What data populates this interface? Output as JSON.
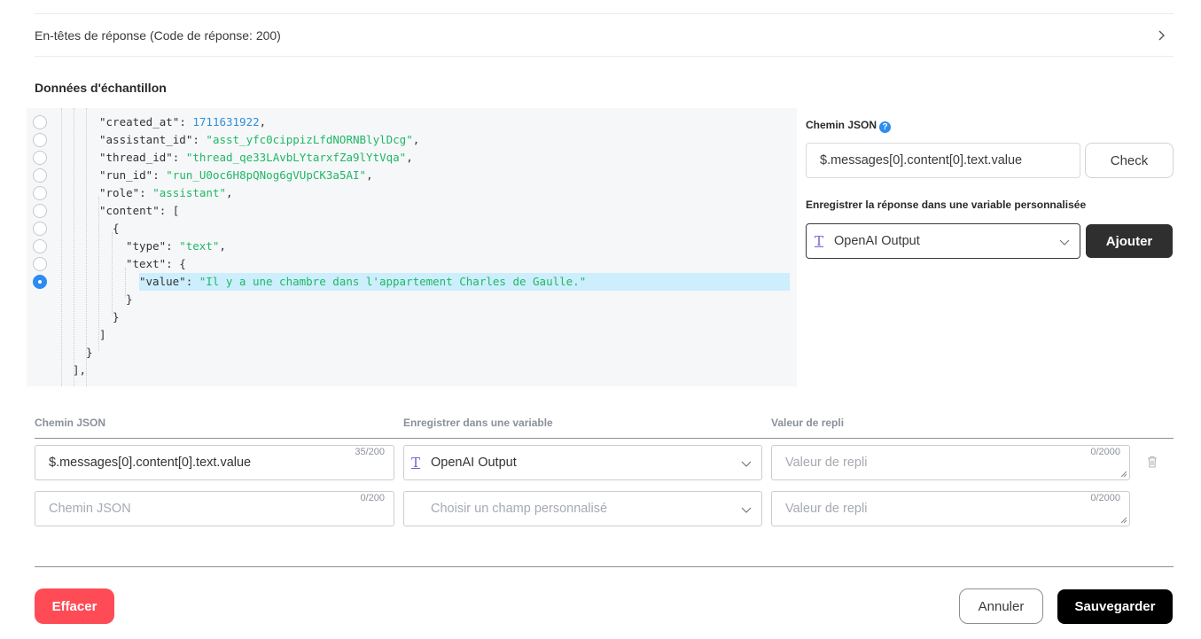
{
  "accordion": {
    "label": "En-têtes de réponse (Code de réponse: 200)",
    "icon": "chevron-right-icon"
  },
  "sample": {
    "title": "Données d'échantillon",
    "lines": [
      {
        "key": "\"created_at\"",
        "sep": ": ",
        "value": "1711631922",
        "vtype": "n",
        "tail": ",",
        "selected": false,
        "has_radio": true
      },
      {
        "key": "\"assistant_id\"",
        "sep": ": ",
        "value": "\"asst_yfc0cippizLfdNORNBlylDcg\"",
        "vtype": "s",
        "tail": ",",
        "selected": false,
        "has_radio": true
      },
      {
        "key": "\"thread_id\"",
        "sep": ": ",
        "value": "\"thread_qe33LAvbLYtarxfZa9lYtVqa\"",
        "vtype": "s",
        "tail": ",",
        "selected": false,
        "has_radio": true
      },
      {
        "key": "\"run_id\"",
        "sep": ": ",
        "value": "\"run_U0oc6H8pQNog6gVUpCK3a5AI\"",
        "vtype": "s",
        "tail": ",",
        "selected": false,
        "has_radio": true
      },
      {
        "key": "\"role\"",
        "sep": ": ",
        "value": "\"assistant\"",
        "vtype": "s",
        "tail": ",",
        "selected": false,
        "has_radio": true
      },
      {
        "key": "\"content\"",
        "sep": ": [",
        "value": "",
        "vtype": "k",
        "tail": "",
        "selected": false,
        "has_radio": true
      },
      {
        "key": "{",
        "sep": "",
        "value": "",
        "vtype": "k",
        "tail": "",
        "selected": false,
        "has_radio": true
      },
      {
        "key": "\"type\"",
        "sep": ": ",
        "value": "\"text\"",
        "vtype": "s",
        "tail": ",",
        "selected": false,
        "has_radio": true
      },
      {
        "key": "\"text\"",
        "sep": ": {",
        "value": "",
        "vtype": "k",
        "tail": "",
        "selected": false,
        "has_radio": true
      },
      {
        "key": "\"value\"",
        "sep": ": ",
        "value": "\"Il y a une chambre dans l'appartement Charles de Gaulle.\"",
        "vtype": "s",
        "tail": "",
        "selected": true,
        "has_radio": true
      },
      {
        "key": "}",
        "sep": "",
        "value": "",
        "vtype": "k",
        "tail": "",
        "selected": false,
        "has_radio": false
      },
      {
        "key": "}",
        "sep": "",
        "value": "",
        "vtype": "k",
        "tail": "",
        "selected": false,
        "has_radio": false
      },
      {
        "key": "]",
        "sep": "",
        "value": "",
        "vtype": "k",
        "tail": "",
        "selected": false,
        "has_radio": false
      },
      {
        "key": "}",
        "sep": "",
        "value": "",
        "vtype": "k",
        "tail": "",
        "selected": false,
        "has_radio": false
      },
      {
        "key": "],",
        "sep": "",
        "value": "",
        "vtype": "k",
        "tail": "",
        "selected": false,
        "has_radio": false
      }
    ]
  },
  "side": {
    "json_path_label": "Chemin JSON",
    "json_path_value": "$.messages[0].content[0].text.value",
    "check_label": "Check",
    "save_label": "Enregistrer la réponse dans une variable personnalisée",
    "variable_value": "OpenAI Output",
    "add_label": "Ajouter"
  },
  "mapping": {
    "headers": {
      "path": "Chemin JSON",
      "variable": "Enregistrer dans une variable",
      "fallback": "Valeur de repli"
    },
    "rows": [
      {
        "path": "$.messages[0].content[0].text.value",
        "path_count": "35/200",
        "variable": "OpenAI Output",
        "fallback_placeholder": "Valeur de repli",
        "fallback_count": "0/2000"
      },
      {
        "path_placeholder": "Chemin JSON",
        "path_count": "0/200",
        "variable_placeholder": "Choisir un champ personnalisé",
        "fallback_placeholder": "Valeur de repli",
        "fallback_count": "0/2000"
      }
    ]
  },
  "footer": {
    "clear_label": "Effacer",
    "cancel_label": "Annuler",
    "save_label": "Sauvegarder"
  },
  "colors": {
    "accent": "#2d8cf0",
    "danger": "#ff4b55",
    "string": "#1fb866",
    "number": "#2f8fd8",
    "highlight": "#cdeefc",
    "variable_icon": "#7b5cd6"
  }
}
